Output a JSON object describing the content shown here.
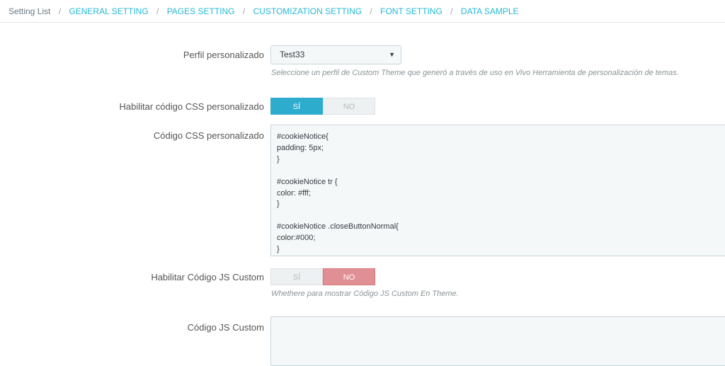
{
  "breadcrumb": {
    "home": "Setting List",
    "links": [
      "GENERAL SETTING",
      "PAGES SETTING",
      "CUSTOMIZATION SETTING",
      "FONT SETTING",
      "DATA SAMPLE"
    ],
    "separator": "/"
  },
  "form": {
    "profile": {
      "label": "Perfil personalizado",
      "value": "Test33",
      "help": "Seleccione un perfil de Custom Theme que generó a través de uso en Vivo Herramienta de personalización de temas."
    },
    "enable_css": {
      "label": "Habilitar código CSS personalizado",
      "yes": "SÍ",
      "no": "NO",
      "selected": "SÍ"
    },
    "css_code": {
      "label": "Código CSS personalizado",
      "value": "#cookieNotice{\npadding: 5px;\n}\n\n#cookieNotice tr {\ncolor: #fff;\n}\n\n#cookieNotice .closeButtonNormal{\ncolor:#000;\n}"
    },
    "enable_js": {
      "label": "Habilitar Código JS Custom",
      "yes": "SÍ",
      "no": "NO",
      "selected": "NO",
      "help": "Whethere para mostrar Código JS Custom En Theme."
    },
    "js_code": {
      "label": "Código JS Custom",
      "value": ""
    }
  },
  "colors": {
    "link": "#25b9d7",
    "toggle_yes_active": "#2eacce",
    "toggle_no_active": "#e08f95"
  }
}
